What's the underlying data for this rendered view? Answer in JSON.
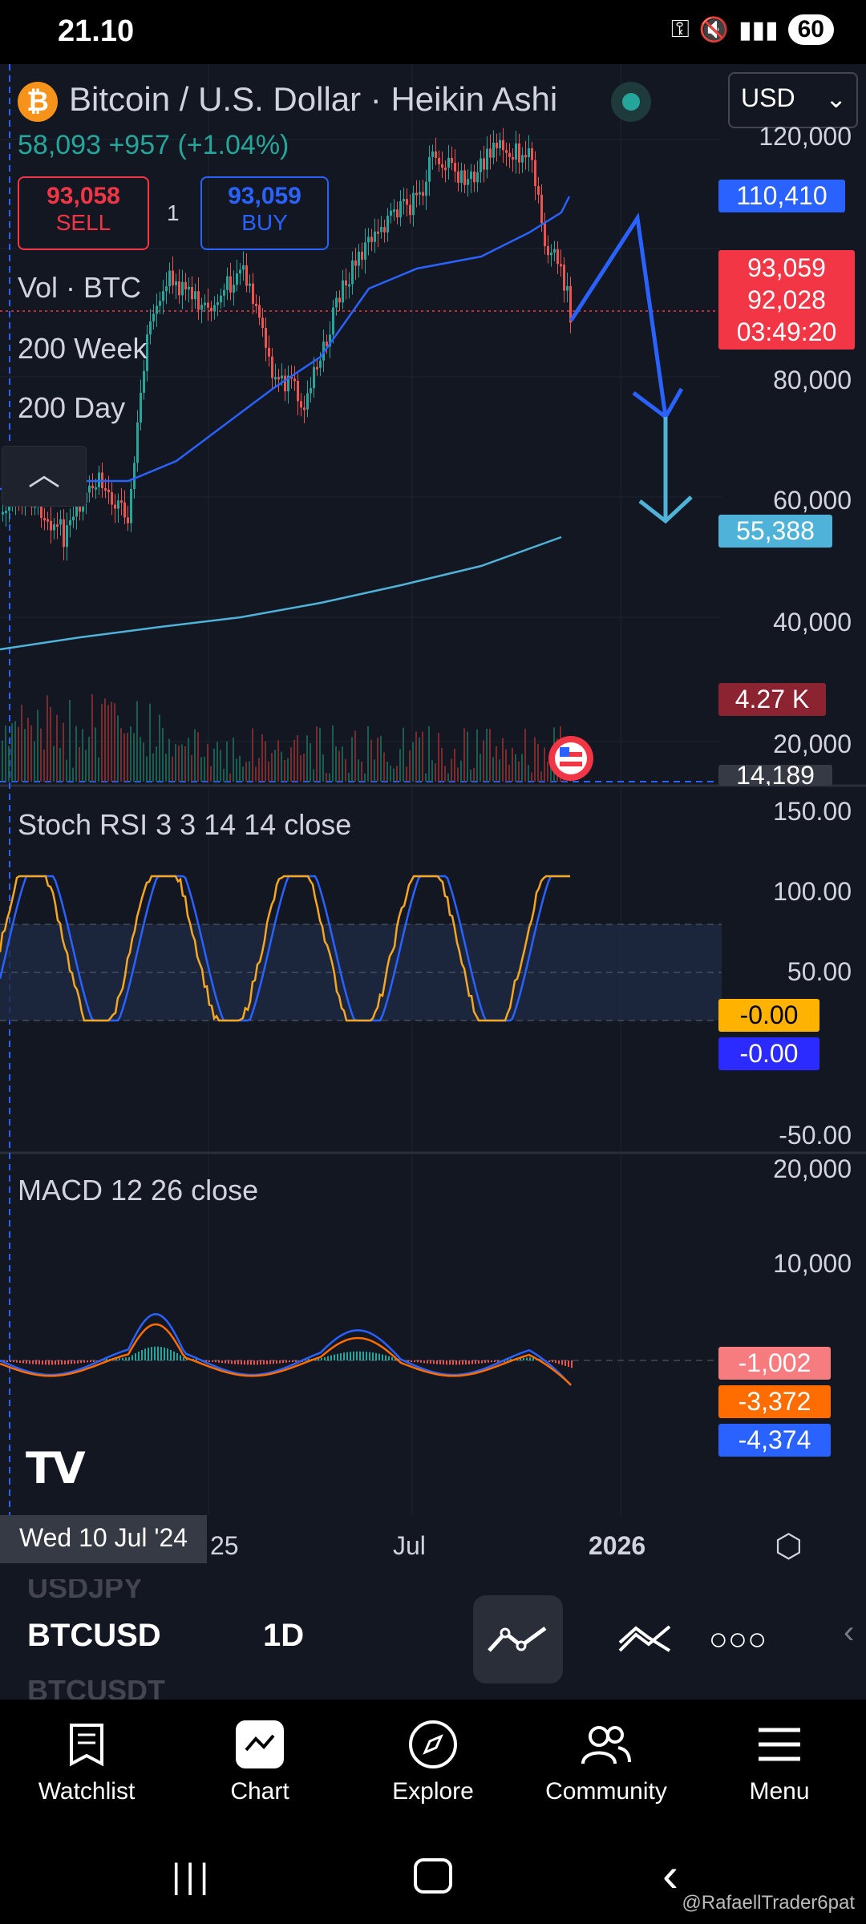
{
  "status_bar": {
    "time": "21.10",
    "battery": "60"
  },
  "header": {
    "symbol_title": "Bitcoin / U.S. Dollar · Heikin Ashi",
    "currency": "USD",
    "ohlc_line": "58,093  +957 (+1.04%)",
    "sell_price": "93,058",
    "sell_label": "SELL",
    "spread": "1",
    "buy_price": "93,059",
    "buy_label": "BUY"
  },
  "indicators_legend": {
    "volume": "Vol · BTC",
    "ma_week": "200 Week",
    "ma_day": "200 Day",
    "collapse_icon": "chevron-up-icon"
  },
  "price_axis": {
    "labels": [
      "120,000",
      "80,000",
      "60,000",
      "40,000",
      "20,000"
    ],
    "tag_blue": "110,410",
    "tag_red_price": "93,059",
    "tag_red_last": "92,028",
    "tag_red_countdown": "03:49:20",
    "tag_cyan": "55,388",
    "tag_volume": "4.27 K",
    "tag_grey": "14,189"
  },
  "stoch_rsi": {
    "title": "Stoch RSI 3 3 14 14 close",
    "labels": [
      "150.00",
      "100.00",
      "50.00",
      "-50.00"
    ],
    "tag_k": "-0.00",
    "tag_d": "-0.00"
  },
  "macd": {
    "title": "MACD 12 26 close",
    "labels": [
      "20,000",
      "10,000"
    ],
    "tag_hist": "-1,002",
    "tag_signal": "-3,372",
    "tag_macd": "-4,374"
  },
  "time_axis": {
    "cursor_date": "Wed 10 Jul '24",
    "labels": [
      "25",
      "Jul",
      "2026"
    ]
  },
  "symbol_bar": {
    "prev_symbol": "USDJPY",
    "symbol": "BTCUSD",
    "next_symbol": "BTCUSDT",
    "interval": "1D"
  },
  "bottom_nav": [
    {
      "label": "Watchlist",
      "icon": "watchlist-icon"
    },
    {
      "label": "Chart",
      "icon": "chart-icon"
    },
    {
      "label": "Explore",
      "icon": "compass-icon"
    },
    {
      "label": "Community",
      "icon": "community-icon"
    },
    {
      "label": "Menu",
      "icon": "menu-icon"
    }
  ],
  "watermark": "@RafaellTrader6pat",
  "colors": {
    "background": "#131722",
    "bull": "#26a69a",
    "bear": "#ef5350",
    "ma_blue": "#2962ff",
    "ma_cyan": "#4fb3d9",
    "stoch_k": "#f5a623",
    "macd_orange": "#ff6d00",
    "red_tag": "#f23645"
  }
}
